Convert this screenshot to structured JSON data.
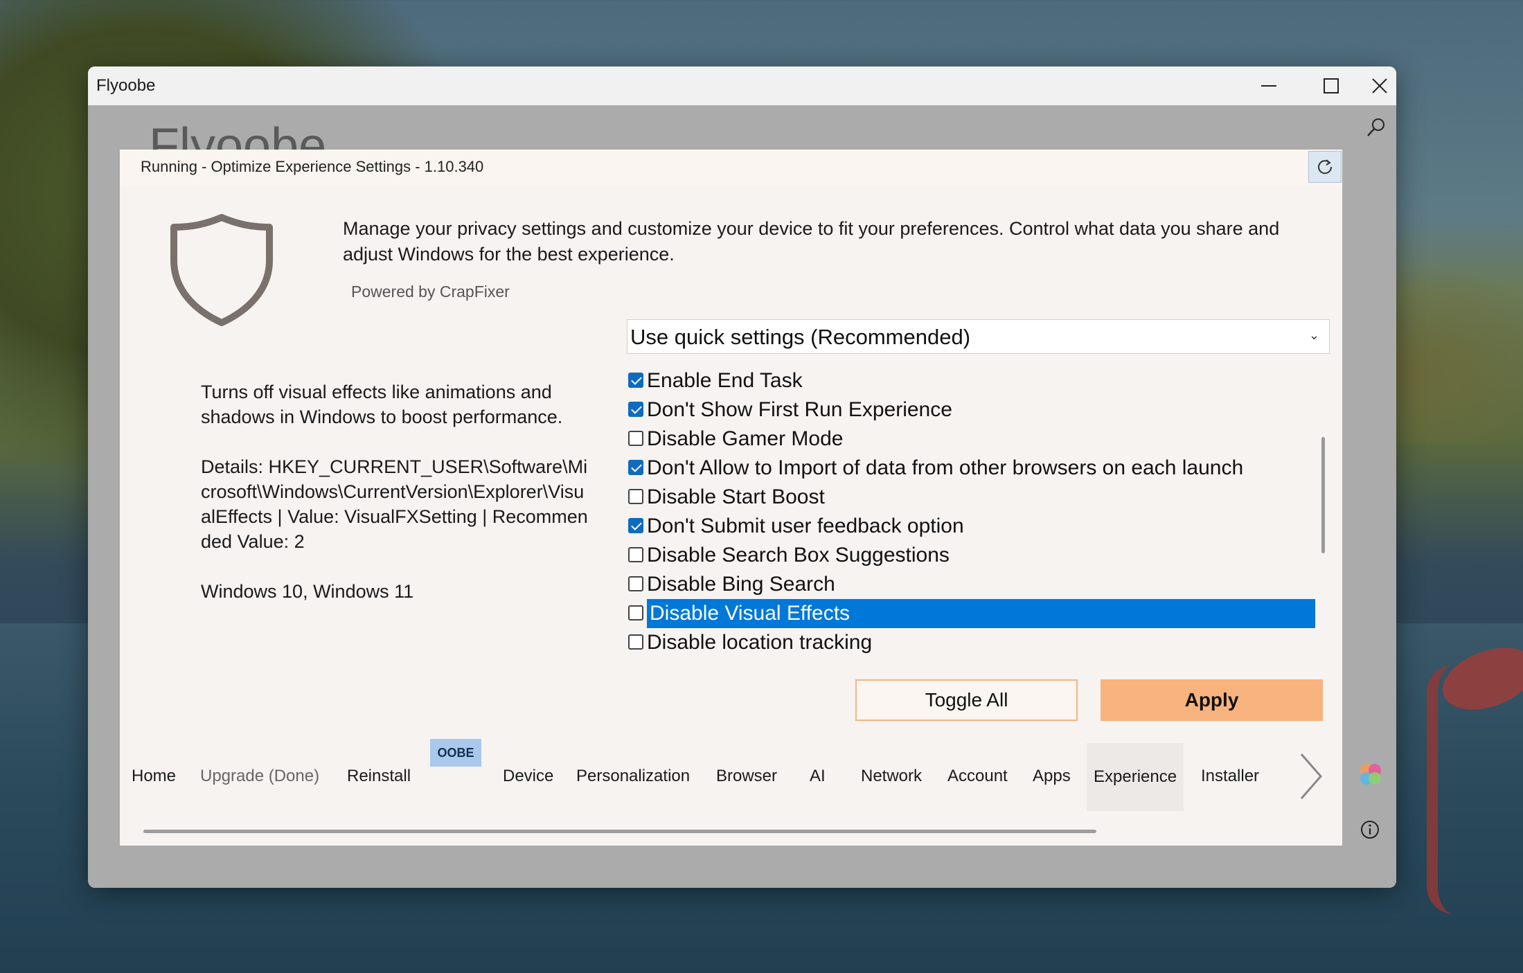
{
  "window": {
    "title": "Flyoobe",
    "app_title": "Flyoobe"
  },
  "dialog": {
    "header": "Running - Optimize Experience Settings - 1.10.340",
    "description": "Manage your privacy settings and customize your device to fit your preferences. Control what data you share and adjust Windows for the best experience.",
    "powered_by": "Powered by CrapFixer",
    "info": {
      "summary": "Turns off visual effects like animations and shadows in Windows to boost performance.",
      "details": "Details: HKEY_CURRENT_USER\\Software\\Microsoft\\Windows\\CurrentVersion\\Explorer\\VisualEffects | Value: VisualFXSetting | Recommended Value: 2",
      "platforms": "Windows 10, Windows 11"
    },
    "mode_select": {
      "value": "Use quick settings (Recommended)"
    },
    "options": [
      {
        "label": "Enable End Task",
        "checked": true
      },
      {
        "label": "Don't Show First Run Experience",
        "checked": true
      },
      {
        "label": "Disable Gamer Mode",
        "checked": false
      },
      {
        "label": "Don't Allow to Import of data from other browsers on each launch",
        "checked": true
      },
      {
        "label": "Disable Start Boost",
        "checked": false
      },
      {
        "label": "Don't Submit user feedback option",
        "checked": true
      },
      {
        "label": "Disable Search Box Suggestions",
        "checked": false
      },
      {
        "label": "Disable Bing Search",
        "checked": false
      },
      {
        "label": "Disable Visual Effects",
        "checked": false,
        "selected": true
      },
      {
        "label": "Disable location tracking",
        "checked": false
      }
    ],
    "buttons": {
      "toggle_all": "Toggle All",
      "apply": "Apply"
    }
  },
  "tabs": {
    "items": [
      "Home",
      "Upgrade (Done)",
      "Reinstall",
      "Device",
      "Personalization",
      "Browser",
      "AI",
      "Network",
      "Account",
      "Apps",
      "Experience",
      "Installer"
    ],
    "badge": "OOBE",
    "active": "Experience"
  },
  "colors": {
    "accent_selection": "#0078d7",
    "checkbox_checked": "#0f6cbd",
    "apply_button": "#f8b37f",
    "toggle_border": "#f3b486"
  }
}
